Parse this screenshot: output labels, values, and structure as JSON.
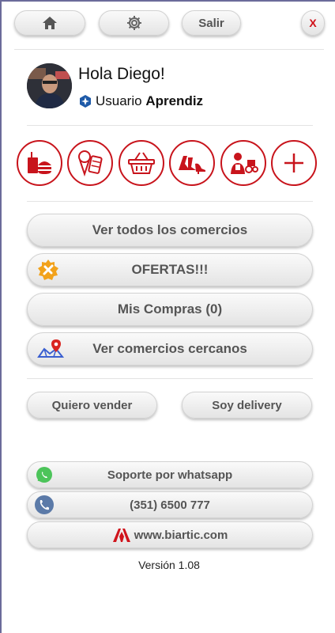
{
  "header": {
    "salir_label": "Salir",
    "close_label": "X"
  },
  "user": {
    "greeting": "Hola Diego!",
    "level_prefix": "Usuario",
    "level_name": "Aprendiz"
  },
  "categories": [
    {
      "name": "comida-icon"
    },
    {
      "name": "helados-dulces-icon"
    },
    {
      "name": "almacen-canasta-icon"
    },
    {
      "name": "moda-calzado-icon"
    },
    {
      "name": "servicios-icon"
    },
    {
      "name": "mas-categorias-icon"
    }
  ],
  "menu": {
    "todos": "Ver todos los comercios",
    "ofertas": "OFERTAS!!!",
    "compras": "Mis Compras (0)",
    "cercanos": "Ver comercios cercanos"
  },
  "actions": {
    "vender": "Quiero vender",
    "delivery": "Soy delivery"
  },
  "contact": {
    "whatsapp": "Soporte por whatsapp",
    "phone": "(351) 6500 777",
    "web": "www.biartic.com"
  },
  "version": "Versión 1.08",
  "colors": {
    "accent": "#c8141c",
    "button_text": "#555555"
  }
}
